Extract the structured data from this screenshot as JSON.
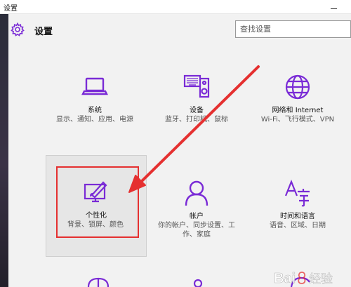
{
  "window": {
    "title": "设置"
  },
  "header": {
    "title": "设置"
  },
  "search": {
    "placeholder": "查找设置"
  },
  "tiles": [
    {
      "name": "系统",
      "desc": "显示、通知、应用、电源",
      "icon": "laptop-icon"
    },
    {
      "name": "设备",
      "desc": "蓝牙、打印机、鼠标",
      "icon": "devices-icon"
    },
    {
      "name": "网络和 Internet",
      "desc": "Wi-Fi、飞行模式、VPN",
      "icon": "globe-icon"
    },
    {
      "name": "个性化",
      "desc": "背景、锁屏、颜色",
      "icon": "personalization-icon"
    },
    {
      "name": "帐户",
      "desc": "你的帐户、同步设置、工作、家庭",
      "icon": "person-icon"
    },
    {
      "name": "时间和语言",
      "desc": "语音、区域、日期",
      "icon": "time-language-icon"
    }
  ],
  "watermark": {
    "text": "Bai经验"
  },
  "colors": {
    "accent": "#7a2bd6",
    "annotation": "#e53030",
    "background": "#f2f2f2"
  }
}
